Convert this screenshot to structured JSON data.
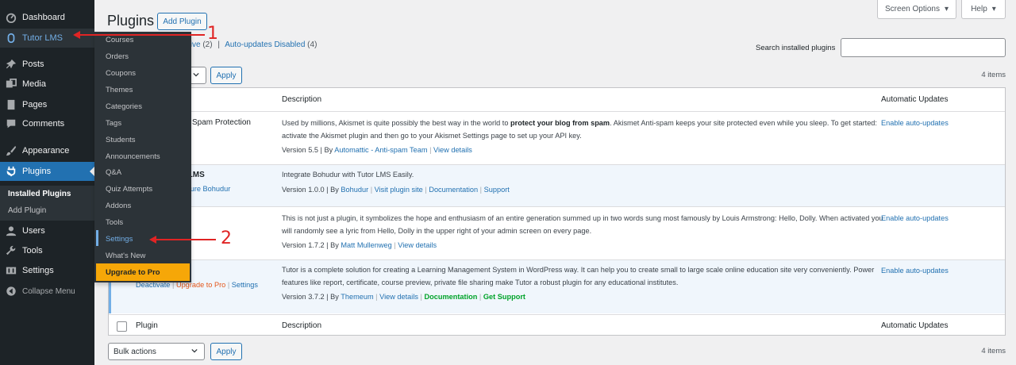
{
  "sidebar": {
    "items": [
      {
        "label": "Dashboard",
        "icon": "dashboard-icon"
      },
      {
        "label": "Tutor LMS",
        "icon": "tutor-icon"
      },
      {
        "label": "Posts",
        "icon": "pin-icon"
      },
      {
        "label": "Media",
        "icon": "media-icon"
      },
      {
        "label": "Pages",
        "icon": "pages-icon"
      },
      {
        "label": "Comments",
        "icon": "comment-icon"
      },
      {
        "label": "Appearance",
        "icon": "brush-icon"
      },
      {
        "label": "Plugins",
        "icon": "plugin-icon"
      },
      {
        "label": "Users",
        "icon": "user-icon"
      },
      {
        "label": "Tools",
        "icon": "wrench-icon"
      },
      {
        "label": "Settings",
        "icon": "settings-icon"
      },
      {
        "label": "Collapse Menu",
        "icon": "collapse-icon"
      }
    ],
    "plugins_sub": {
      "installed": "Installed Plugins",
      "add": "Add Plugin"
    }
  },
  "tutor_flyout": {
    "items": [
      "Courses",
      "Orders",
      "Coupons",
      "Themes",
      "Categories",
      "Tags",
      "Students",
      "Announcements",
      "Q&A",
      "Quiz Attempts",
      "Addons",
      "Tools",
      "Settings",
      "What's New"
    ],
    "upgrade": "Upgrade to Pro"
  },
  "annotations": {
    "one": "1",
    "two": "2"
  },
  "header": {
    "title": "Plugins",
    "add_plugin": "Add Plugin",
    "screen_options": "Screen Options",
    "help": "Help"
  },
  "filters": {
    "inactive": "ctive",
    "inactive_count": "(2)",
    "sep": "|",
    "auto_disabled": "Auto-updates Disabled",
    "auto_disabled_count": "(4)"
  },
  "search": {
    "label": "Search installed plugins",
    "placeholder": ""
  },
  "bulk": {
    "label": "Bulk actions",
    "apply": "Apply",
    "count": "4 items"
  },
  "table": {
    "col_plugin": "Plugin",
    "col_description": "Description",
    "col_auto": "Automatic Updates",
    "rows": [
      {
        "name": "pam: Spam Protection",
        "desc_pre": "Used by millions, Akismet is quite possibly the best way in the world to ",
        "desc_bold": "protect your blog from spam",
        "desc_post": ". Akismet Anti-spam keeps your site protected even while you sleep. To get started: activate the Akismet plugin and then go to your Akismet Settings page to set up your API key.",
        "version": "Version 5.5 | By ",
        "author": "Automattic - Anti-spam Team",
        "details": "View details",
        "auto": "Enable auto-updates"
      },
      {
        "name": "r LMS",
        "by_line": "figure Bohudur",
        "desc": "Integrate Bohudur with Tutor LMS Easily.",
        "version": "Version 1.0.0 | By ",
        "author": "Bohudur",
        "site": "Visit plugin site",
        "docs": "Documentation",
        "support": "Support"
      },
      {
        "desc": "This is not just a plugin, it symbolizes the hope and enthusiasm of an entire generation summed up in two words sung most famously by Louis Armstrong: Hello, Dolly. When activated you will randomly see a lyric from Hello, Dolly in the upper right of your admin screen on every page.",
        "version": "Version 1.7.2 | By ",
        "author": "Matt Mullenweg",
        "details": "View details",
        "auto": "Enable auto-updates"
      },
      {
        "desc": "Tutor is a complete solution for creating a Learning Management System in WordPress way. It can help you to create small to large scale online education site very conveniently. Power features like report, certificate, course preview, private file sharing make Tutor a robust plugin for any educational institutes.",
        "version": "Version 3.7.2 | By ",
        "author": "Themeum",
        "details": "View details",
        "docs": "Documentation",
        "support": "Get Support",
        "action_deactivate": "Deactivate",
        "action_upgrade": "Upgrade to Pro",
        "action_settings": "Settings",
        "auto": "Enable auto-updates"
      }
    ]
  }
}
